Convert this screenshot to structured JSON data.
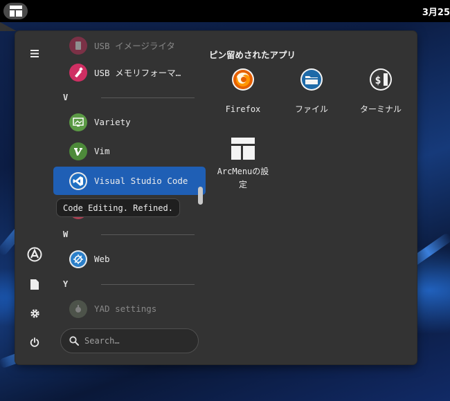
{
  "topbar": {
    "clock": "3月25"
  },
  "menu": {
    "apps": [
      {
        "label": "USB イメージライタ",
        "icon": "usb-image-writer-icon",
        "color": "#d2305e",
        "faded": true
      },
      {
        "label": "USB メモリフォーマ…",
        "icon": "usb-stick-formatter-icon",
        "color": "#cf2f63"
      },
      {
        "label": "Variety",
        "icon": "variety-icon",
        "color": "#5b9a45"
      },
      {
        "label": "Vim",
        "icon": "vim-icon",
        "color": "#4d8a3a"
      },
      {
        "label": "Visual Studio Code",
        "icon": "vscode-icon",
        "color": "#1f6fc2",
        "selected": true
      },
      {
        "label": "Web",
        "icon": "web-browser-icon",
        "color": "#2b7fc9"
      },
      {
        "label": "YAD settings",
        "icon": "yad-settings-icon",
        "color": "#6e7a66",
        "faded": true
      }
    ],
    "sections": [
      "V",
      "W",
      "Y"
    ],
    "tooltip": "Code Editing. Refined.",
    "search": {
      "placeholder": "Search…"
    },
    "pinned": {
      "title": "ピン留めされたアプリ",
      "items": [
        {
          "label": "Firefox",
          "icon": "firefox-icon"
        },
        {
          "label": "ファイル",
          "icon": "files-icon"
        },
        {
          "label": "ターミナル",
          "icon": "terminal-icon"
        },
        {
          "label": "ArcMenuの設\n定",
          "line1": "ArcMenuの設",
          "line2": "定",
          "icon": "arcmenu-settings-icon"
        }
      ]
    },
    "rail": {
      "hamburger": "hamburger-menu-icon",
      "user": "user-avatar-icon",
      "documents": "documents-icon",
      "settings": "settings-gear-icon",
      "power": "power-icon"
    }
  },
  "colors": {
    "selected": "#1f5fb5",
    "panel": "#333333",
    "accent": "#1f6fc2"
  }
}
